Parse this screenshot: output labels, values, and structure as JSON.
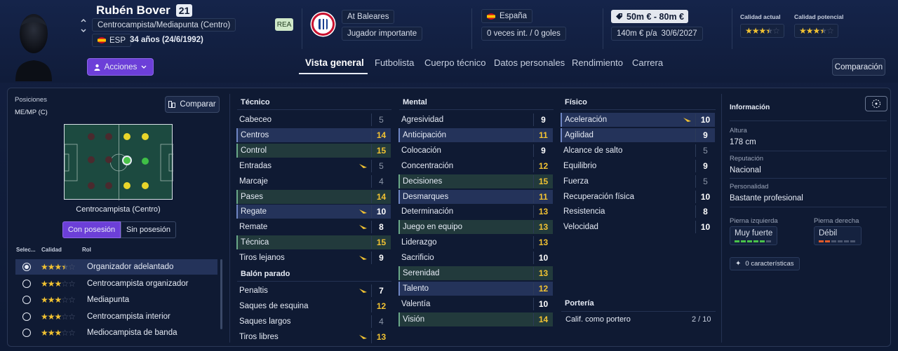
{
  "header": {
    "name": "Rubén Bover",
    "number": "21",
    "position": "Centrocampista/Mediapunta (Centro)",
    "nation_code": "ESP",
    "age": "34 años (24/6/1992)",
    "status_tag": "REA",
    "actions_label": "Acciones",
    "club": "At Baleares",
    "role_status": "Jugador importante",
    "country": "España",
    "caps": "0 veces int. / 0 goles",
    "value": "50m € - 80m €",
    "wage": "140m € p/a",
    "contract": "30/6/2027",
    "current_quality_label": "Calidad actual",
    "potential_quality_label": "Calidad potencial",
    "current_stars": 3.5,
    "potential_stars": 3.5,
    "compare_label": "Comparación"
  },
  "tabs": [
    "Vista general",
    "Futbolista",
    "Cuerpo técnico",
    "Datos personales",
    "Rendimiento",
    "Carrera"
  ],
  "left": {
    "positions_label": "Posiciones",
    "positions_value": "ME/MP (C)",
    "compare_btn": "Comparar",
    "pitch_role": "Centrocampista (Centro)",
    "toggle_on": "Con posesión",
    "toggle_off": "Sin posesión",
    "col_select": "Selec...",
    "col_quality": "Calidad",
    "col_role": "Rol",
    "roles": [
      {
        "name": "Organizador adelantado",
        "stars": 3.5,
        "selected": true
      },
      {
        "name": "Centrocampista organizador",
        "stars": 3,
        "selected": false
      },
      {
        "name": "Mediapunta",
        "stars": 3,
        "selected": false
      },
      {
        "name": "Centrocampista interior",
        "stars": 3,
        "selected": false
      },
      {
        "name": "Mediocampista de banda",
        "stars": 3,
        "selected": false
      }
    ]
  },
  "tecnico": {
    "title": "Técnico",
    "items": [
      {
        "n": "Cabeceo",
        "v": "5",
        "c": "dim",
        "h": ""
      },
      {
        "n": "Centros",
        "v": "14",
        "c": "yel",
        "h": "blue"
      },
      {
        "n": "Control",
        "v": "15",
        "c": "yel",
        "h": "green"
      },
      {
        "n": "Entradas",
        "v": "5",
        "c": "dim",
        "h": "",
        "a": true
      },
      {
        "n": "Marcaje",
        "v": "4",
        "c": "dim",
        "h": ""
      },
      {
        "n": "Pases",
        "v": "14",
        "c": "yel",
        "h": "green"
      },
      {
        "n": "Regate",
        "v": "10",
        "c": "wht",
        "h": "blue",
        "a": true
      },
      {
        "n": "Remate",
        "v": "8",
        "c": "wht",
        "h": "",
        "a": true
      },
      {
        "n": "Técnica",
        "v": "15",
        "c": "yel",
        "h": "green"
      },
      {
        "n": "Tiros lejanos",
        "v": "9",
        "c": "wht",
        "h": "",
        "a": true
      }
    ]
  },
  "balon": {
    "title": "Balón parado",
    "items": [
      {
        "n": "Penaltis",
        "v": "7",
        "c": "wht",
        "h": "",
        "a": true
      },
      {
        "n": "Saques de esquina",
        "v": "12",
        "c": "yel",
        "h": ""
      },
      {
        "n": "Saques largos",
        "v": "4",
        "c": "dim",
        "h": ""
      },
      {
        "n": "Tiros libres",
        "v": "13",
        "c": "yel",
        "h": "",
        "a": true
      }
    ]
  },
  "mental": {
    "title": "Mental",
    "items": [
      {
        "n": "Agresividad",
        "v": "9",
        "c": "wht",
        "h": ""
      },
      {
        "n": "Anticipación",
        "v": "11",
        "c": "yel",
        "h": "blue"
      },
      {
        "n": "Colocación",
        "v": "9",
        "c": "wht",
        "h": ""
      },
      {
        "n": "Concentración",
        "v": "12",
        "c": "yel",
        "h": ""
      },
      {
        "n": "Decisiones",
        "v": "15",
        "c": "yel",
        "h": "green"
      },
      {
        "n": "Desmarques",
        "v": "11",
        "c": "yel",
        "h": "blue"
      },
      {
        "n": "Determinación",
        "v": "13",
        "c": "yel",
        "h": ""
      },
      {
        "n": "Juego en equipo",
        "v": "13",
        "c": "yel",
        "h": "green"
      },
      {
        "n": "Liderazgo",
        "v": "13",
        "c": "yel",
        "h": ""
      },
      {
        "n": "Sacrificio",
        "v": "10",
        "c": "wht",
        "h": ""
      },
      {
        "n": "Serenidad",
        "v": "13",
        "c": "yel",
        "h": "green"
      },
      {
        "n": "Talento",
        "v": "12",
        "c": "yel",
        "h": "blue"
      },
      {
        "n": "Valentía",
        "v": "10",
        "c": "wht",
        "h": ""
      },
      {
        "n": "Visión",
        "v": "14",
        "c": "yel",
        "h": "green"
      }
    ]
  },
  "fisico": {
    "title": "Físico",
    "items": [
      {
        "n": "Aceleración",
        "v": "10",
        "c": "wht",
        "h": "blue",
        "a": true
      },
      {
        "n": "Agilidad",
        "v": "9",
        "c": "wht",
        "h": "blue"
      },
      {
        "n": "Alcance de salto",
        "v": "5",
        "c": "dim",
        "h": ""
      },
      {
        "n": "Equilibrio",
        "v": "9",
        "c": "wht",
        "h": ""
      },
      {
        "n": "Fuerza",
        "v": "5",
        "c": "dim",
        "h": ""
      },
      {
        "n": "Recuperación física",
        "v": "10",
        "c": "wht",
        "h": ""
      },
      {
        "n": "Resistencia",
        "v": "8",
        "c": "wht",
        "h": ""
      },
      {
        "n": "Velocidad",
        "v": "10",
        "c": "wht",
        "h": ""
      }
    ]
  },
  "porteria": {
    "title": "Portería",
    "label": "Calif. como portero",
    "value": "2 / 10"
  },
  "info": {
    "title": "Información",
    "height_label": "Altura",
    "height": "178 cm",
    "reputation_label": "Reputación",
    "reputation": "Nacional",
    "personality_label": "Personalidad",
    "personality": "Bastante profesional",
    "left_foot_label": "Pierna izquierda",
    "left_foot": "Muy fuerte",
    "right_foot_label": "Pierna derecha",
    "right_foot": "Débil",
    "left_foot_level": 5,
    "right_foot_level": 2,
    "traits": "0 características"
  },
  "colors": {
    "accent": "#6c3fd8",
    "yellow": "#f1c232",
    "green": "#49c24a"
  }
}
